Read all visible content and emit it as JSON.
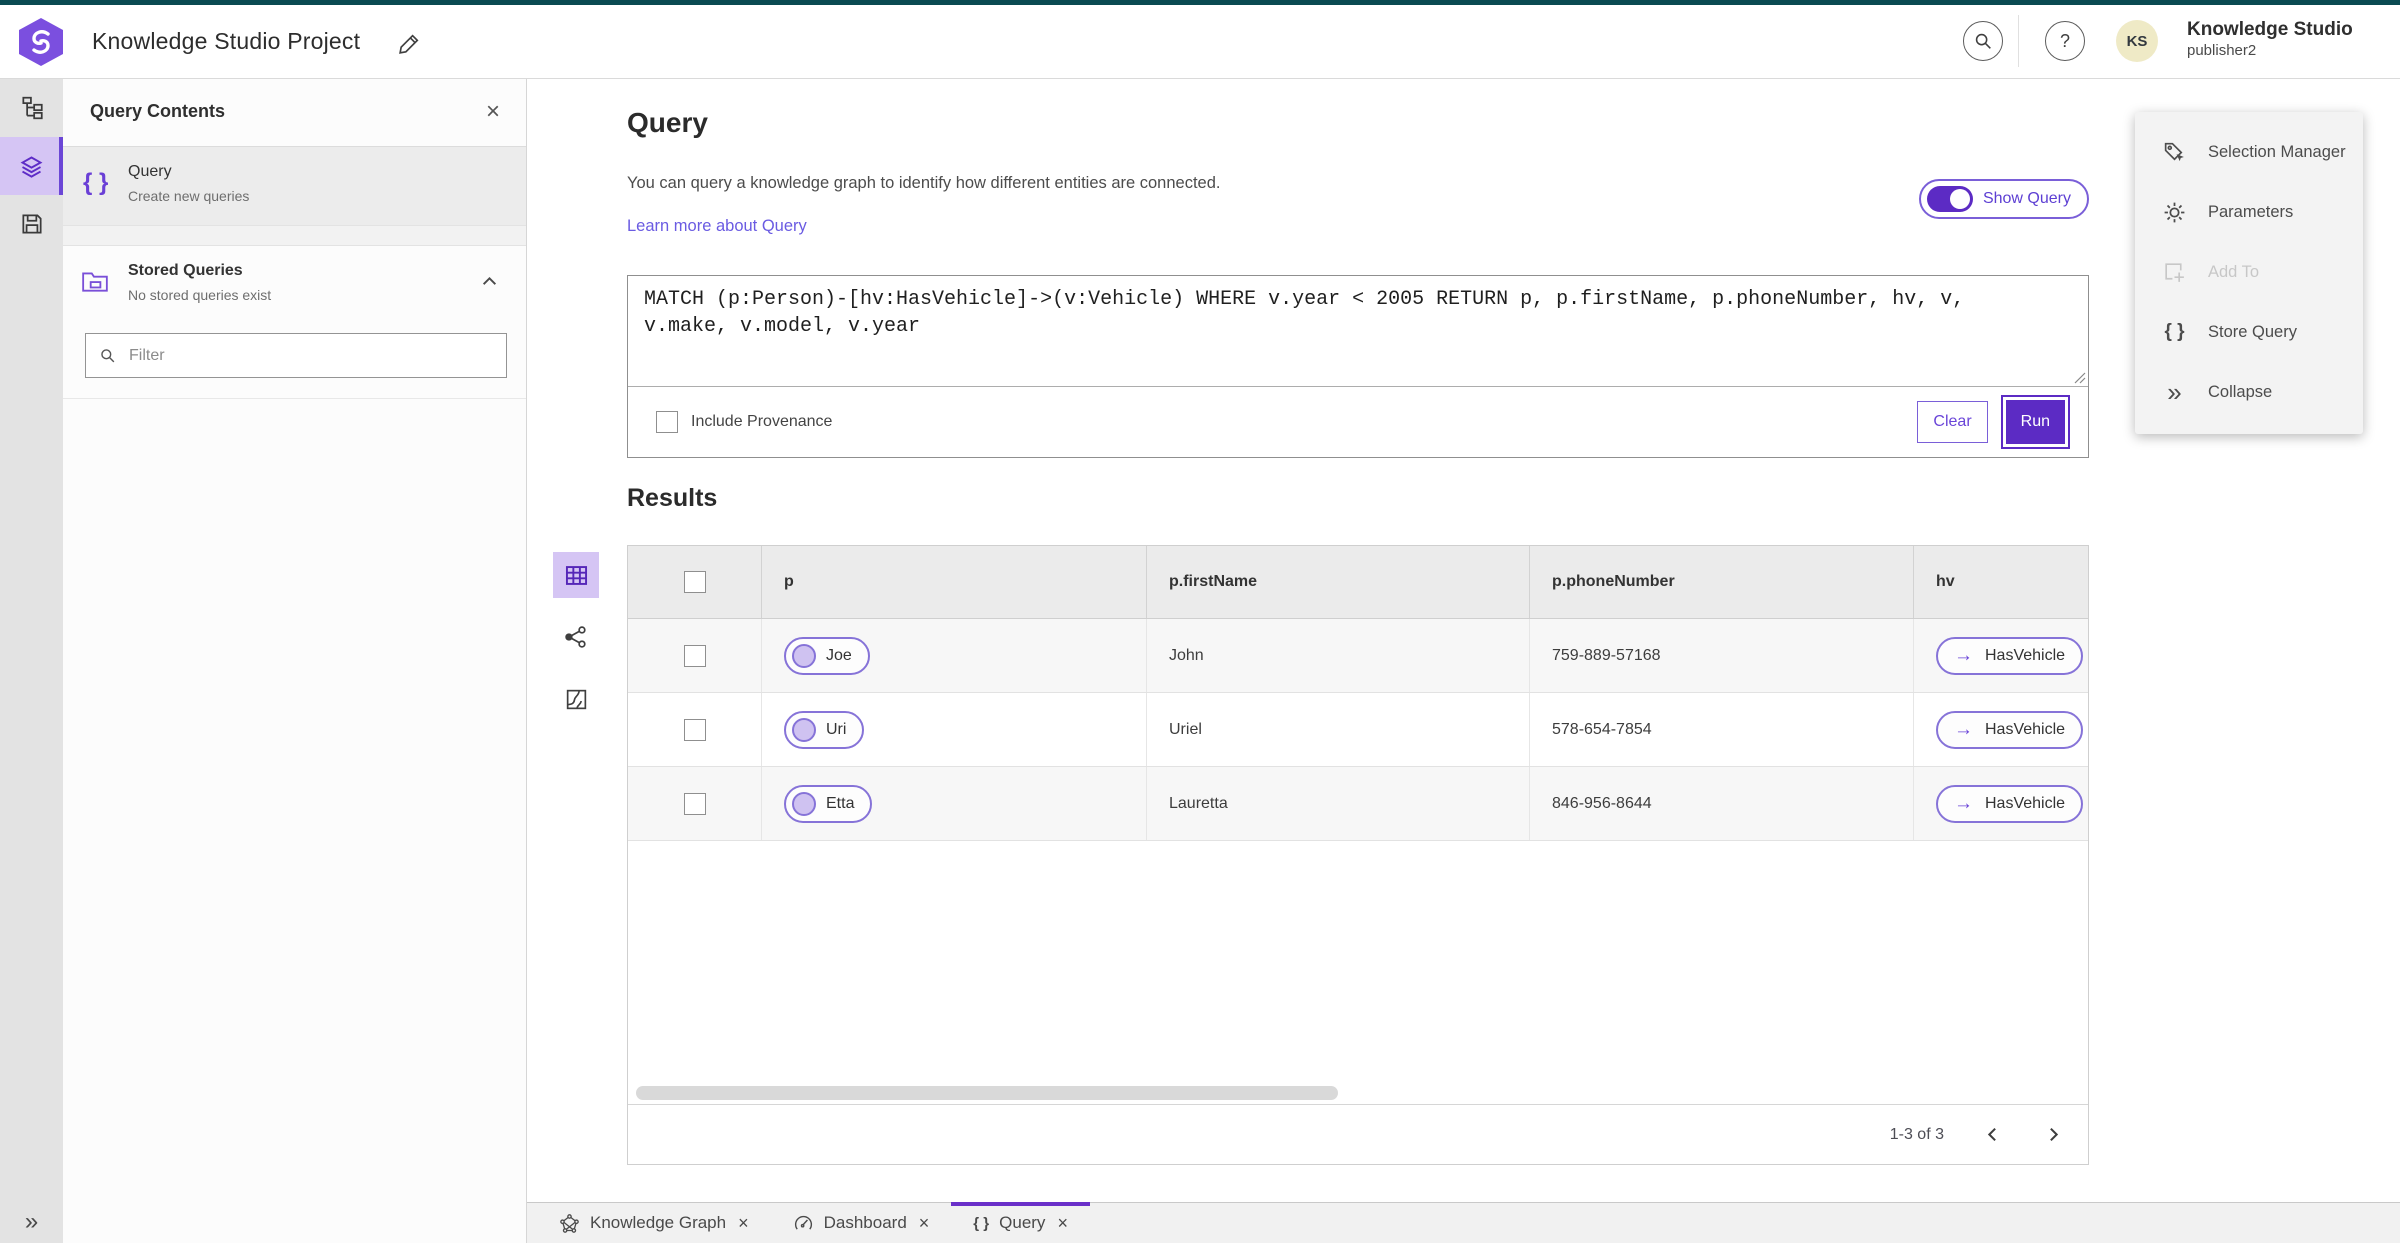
{
  "glyphs": {
    "braces": "{ }",
    "close": "×",
    "collapse": "»",
    "arrow": "→",
    "question": "?"
  },
  "colors": {
    "accent_purple": "#5c2bc4",
    "purple_border": "#8673d8",
    "active_light_purple": "#d5c5f4",
    "link_purple": "#6a5be2",
    "teal_top": "#0a4a52",
    "avatar_bg": "#efeac6"
  },
  "header": {
    "app_title": "Knowledge Studio Project",
    "user": {
      "name": "Knowledge Studio",
      "role": "publisher2",
      "initials": "KS"
    }
  },
  "contents_panel": {
    "title": "Query Contents",
    "query_item": {
      "title": "Query",
      "subtitle": "Create new queries"
    },
    "stored_item": {
      "title": "Stored Queries",
      "subtitle": "No stored queries exist"
    },
    "filter_placeholder": "Filter"
  },
  "query_section": {
    "title": "Query",
    "description": "You can query a knowledge graph to identify how different entities are connected.",
    "learn_more": "Learn more about Query",
    "show_query": "Show Query",
    "query_text": "MATCH (p:Person)-[hv:HasVehicle]->(v:Vehicle) WHERE v.year < 2005 RETURN p, p.firstName, p.phoneNumber, hv, v, v.make, v.model, v.year",
    "include_provenance": "Include Provenance",
    "clear": "Clear",
    "run": "Run"
  },
  "results": {
    "title": "Results",
    "columns": [
      "p",
      "p.firstName",
      "p.phoneNumber",
      "hv"
    ],
    "rows": [
      {
        "p": "Joe",
        "firstName": "John",
        "phone": "759-889-57168",
        "hv": "HasVehicle"
      },
      {
        "p": "Uri",
        "firstName": "Uriel",
        "phone": "578-654-7854",
        "hv": "HasVehicle"
      },
      {
        "p": "Etta",
        "firstName": "Lauretta",
        "phone": "846-956-8644",
        "hv": "HasVehicle"
      }
    ],
    "pagination": {
      "label": "1-3 of 3"
    }
  },
  "right_panel": {
    "items": [
      {
        "label": "Selection Manager"
      },
      {
        "label": "Parameters"
      },
      {
        "label": "Add To"
      },
      {
        "label": "Store Query"
      },
      {
        "label": "Collapse"
      }
    ]
  },
  "tabs": [
    {
      "label": "Knowledge Graph"
    },
    {
      "label": "Dashboard"
    },
    {
      "label": "Query"
    }
  ]
}
